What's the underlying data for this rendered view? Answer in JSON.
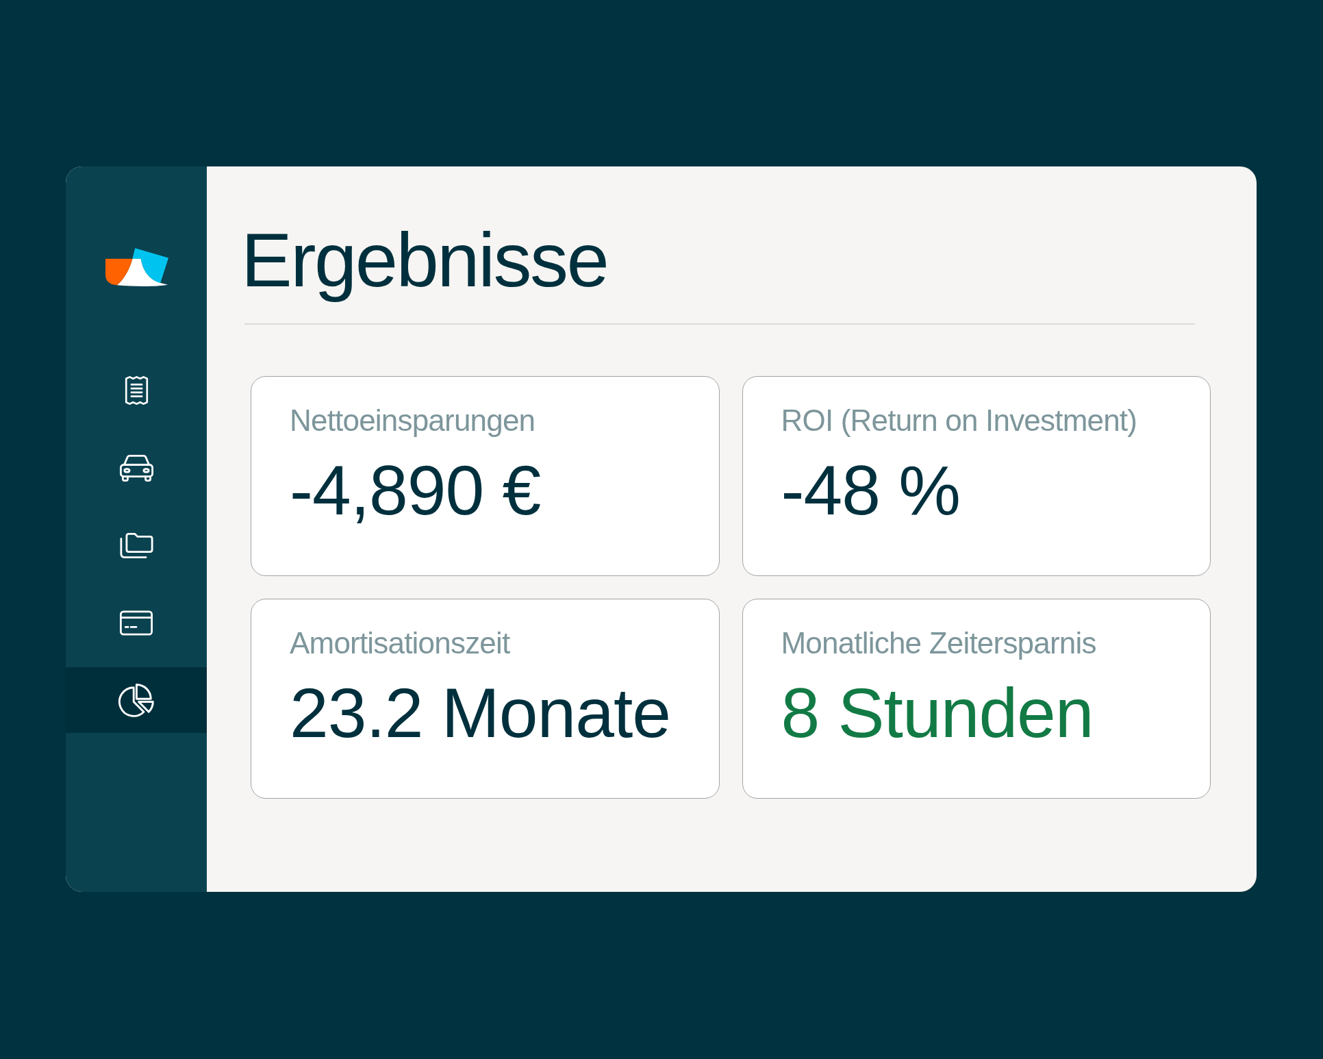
{
  "sidebar": {
    "nav": [
      {
        "selected": false
      },
      {
        "selected": false
      },
      {
        "selected": false
      },
      {
        "selected": false
      },
      {
        "selected": true
      }
    ]
  },
  "title": "Ergebnisse",
  "metrics": [
    {
      "label": "Nettoeinsparungen",
      "value": "-4,890 €",
      "color": "#00303d"
    },
    {
      "label": "ROI (Return on Investment)",
      "value": "-48 %",
      "color": "#00303d"
    },
    {
      "label": "Amortisationszeit",
      "value": "23.2 Monate",
      "color": "#00303d"
    },
    {
      "label": "Monatliche Zeitersparnis",
      "value": "8 Stunden",
      "color": "#127a45"
    }
  ]
}
